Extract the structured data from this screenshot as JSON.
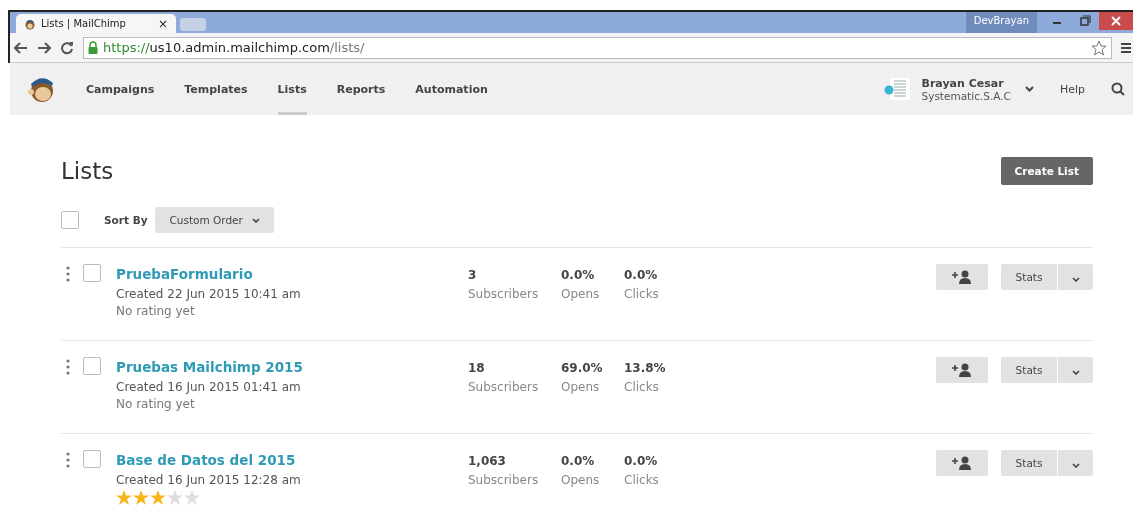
{
  "browser": {
    "tab_title": "Lists | MailChimp",
    "tab_close": "×",
    "profile": "DevBrayan",
    "url_scheme": "https://",
    "url_host": "us10.admin.mailchimp.com",
    "url_path": "/lists/"
  },
  "nav": {
    "items": [
      {
        "label": "Campaigns",
        "selected": false
      },
      {
        "label": "Templates",
        "selected": false
      },
      {
        "label": "Lists",
        "selected": true
      },
      {
        "label": "Reports",
        "selected": false
      },
      {
        "label": "Automation",
        "selected": false
      }
    ],
    "user_name": "Brayan Cesar",
    "user_company": "Systematic.S.A.C",
    "help": "Help"
  },
  "page": {
    "title": "Lists",
    "create_button": "Create List",
    "sort_label": "Sort By",
    "sort_value": "Custom Order",
    "select_all_checked": false
  },
  "lists": [
    {
      "name": "PruebaFormulario",
      "created": "Created 22 Jun 2015 10:41 am",
      "rating": "No rating yet",
      "checked": false,
      "subscribers": "3",
      "subscribers_label": "Subscribers",
      "opens": "0.0%",
      "opens_label": "Opens",
      "clicks": "0.0%",
      "clicks_label": "Clicks",
      "stats_button": "Stats"
    },
    {
      "name": "Pruebas Mailchimp 2015",
      "created": "Created 16 Jun 2015 01:41 am",
      "rating": "No rating yet",
      "checked": false,
      "subscribers": "18",
      "subscribers_label": "Subscribers",
      "opens": "69.0%",
      "opens_label": "Opens",
      "clicks": "13.8%",
      "clicks_label": "Clicks",
      "stats_button": "Stats"
    },
    {
      "name": "Base de Datos del 2015",
      "created": "Created 16 Jun 2015 12:28 am",
      "stars": 3,
      "checked": false,
      "subscribers": "1,063",
      "subscribers_label": "Subscribers",
      "opens": "0.0%",
      "opens_label": "Opens",
      "clicks": "0.0%",
      "clicks_label": "Clicks",
      "stats_button": "Stats"
    }
  ]
}
